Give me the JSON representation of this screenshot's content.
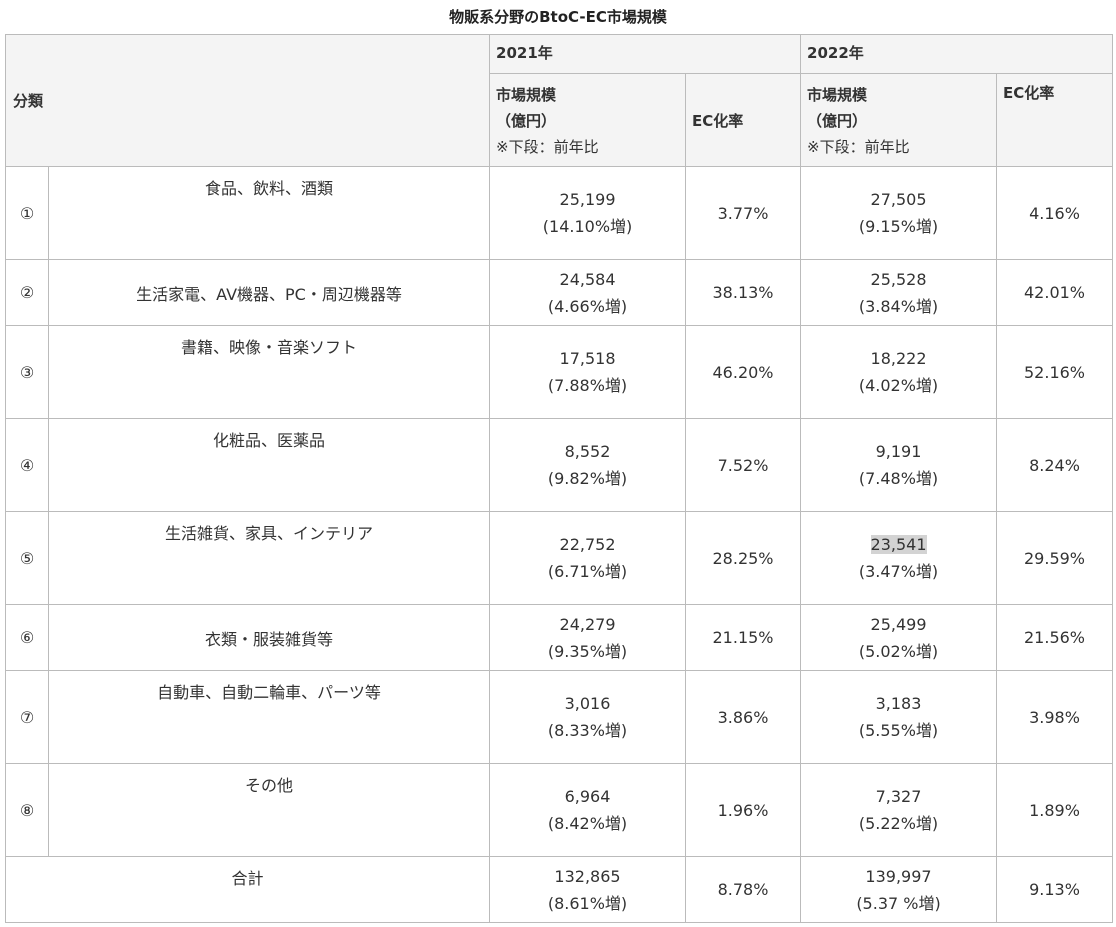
{
  "title": "物販系分野のBtoC-EC市場規模",
  "headers": {
    "category": "分類",
    "year1": "2021年",
    "year2": "2022年",
    "market_line1": "市場規模",
    "market_line2": "（億円）",
    "market_note": "※下段：前年比",
    "ec_rate": "EC化率"
  },
  "rows": [
    {
      "num": "①",
      "name": "食品、飲料、酒類",
      "v1": "25,199",
      "g1": "(14.10%増)",
      "r1": "3.77%",
      "v2": "27,505",
      "g2": "(9.15%増)",
      "r2": "4.16%"
    },
    {
      "num": "②",
      "name": "生活家電、AV機器、PC・周辺機器等",
      "v1": "24,584",
      "g1": "(4.66%増)",
      "r1": "38.13%",
      "v2": "25,528",
      "g2": "(3.84%増)",
      "r2": "42.01%"
    },
    {
      "num": "③",
      "name": "書籍、映像・音楽ソフト",
      "v1": "17,518",
      "g1": "(7.88%増)",
      "r1": "46.20%",
      "v2": "18,222",
      "g2": "(4.02%増)",
      "r2": "52.16%"
    },
    {
      "num": "④",
      "name": "化粧品、医薬品",
      "v1": "8,552",
      "g1": "(9.82%増)",
      "r1": "7.52%",
      "v2": "9,191",
      "g2": "(7.48%増)",
      "r2": "8.24%"
    },
    {
      "num": "⑤",
      "name": "生活雑貨、家具、インテリア",
      "v1": "22,752",
      "g1": "(6.71%増)",
      "r1": "28.25%",
      "v2": "23,541",
      "g2": "(3.47%増)",
      "r2": "29.59%"
    },
    {
      "num": "⑥",
      "name": "衣類・服装雑貨等",
      "v1": "24,279",
      "g1": "(9.35%増)",
      "r1": "21.15%",
      "v2": "25,499",
      "g2": "(5.02%増)",
      "r2": "21.56%"
    },
    {
      "num": "⑦",
      "name": "自動車、自動二輪車、パーツ等",
      "v1": "3,016",
      "g1": "(8.33%増)",
      "r1": "3.86%",
      "v2": "3,183",
      "g2": "(5.55%増)",
      "r2": "3.98%"
    },
    {
      "num": "⑧",
      "name": "その他",
      "v1": "6,964",
      "g1": "(8.42%増)",
      "r1": "1.96%",
      "v2": "7,327",
      "g2": "(5.22%増)",
      "r2": "1.89%"
    }
  ],
  "total": {
    "name": "合計",
    "v1": "132,865",
    "g1": "(8.61%増)",
    "r1": "8.78%",
    "v2": "139,997",
    "g2": "(5.37 %増)",
    "r2": "9.13%"
  }
}
